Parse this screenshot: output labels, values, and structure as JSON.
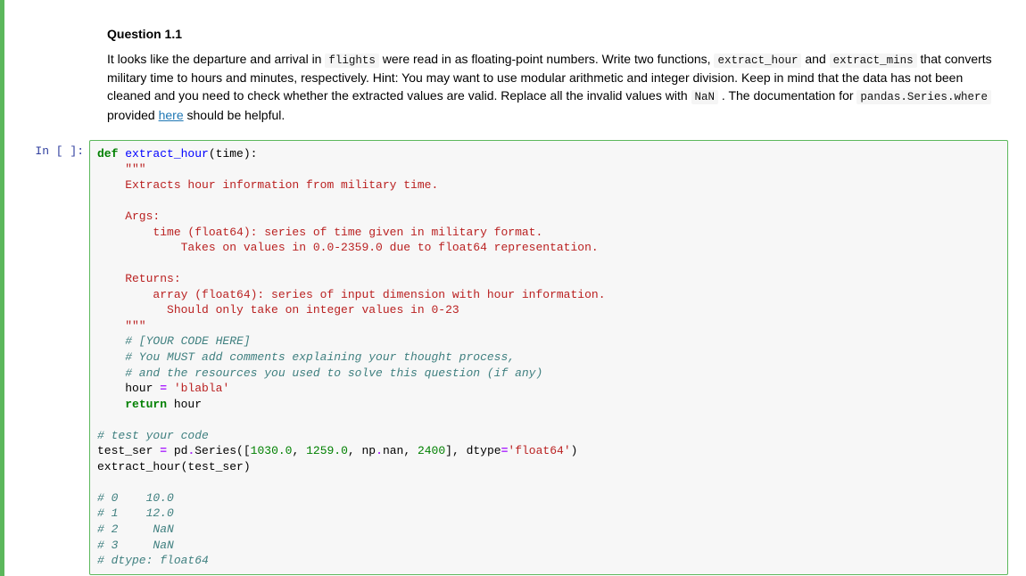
{
  "md": {
    "title": "Question 1.1",
    "p1_a": "It looks like the departure and arrival in ",
    "c_flights": "flights",
    "p1_b": " were read in as floating-point numbers. Write two functions, ",
    "c_eh": "extract_hour",
    "p1_c": " and ",
    "c_em": "extract_mins",
    "p1_d": " that converts military time to hours and minutes, respectively. Hint: You may want to use modular arithmetic and integer division. Keep in mind that the data has not been cleaned and you need to check whether the extracted values are valid. Replace all the invalid values with ",
    "c_nan": "NaN",
    "p1_e": " . The documentation for ",
    "c_psw": "pandas.Series.where",
    "p1_f": " provided ",
    "link": "here",
    "p1_g": " should be helpful."
  },
  "cell": {
    "prompt": "In [ ]:",
    "code": {
      "l1a": "def",
      "l1b": " ",
      "l1c": "extract_hour",
      "l1d": "(time):",
      "l2": "    \"\"\"",
      "l3": "    Extracts hour information from military time.",
      "l4": "",
      "l5": "    Args:",
      "l6": "        time (float64): series of time given in military format.  ",
      "l7": "            Takes on values in 0.0-2359.0 due to float64 representation.",
      "l8": "",
      "l9": "    Returns:",
      "l10": "        array (float64): series of input dimension with hour information.  ",
      "l11": "          Should only take on integer values in 0-23",
      "l12": "    \"\"\"",
      "l13": "    # [YOUR CODE HERE]",
      "l14": "    # You MUST add comments explaining your thought process,",
      "l15": "    # and the resources you used to solve this question (if any)",
      "l16a": "    hour ",
      "l16b": "=",
      "l16c": " ",
      "l16d": "'blabla'",
      "l17a": "    ",
      "l17b": "return",
      "l17c": " hour",
      "l18": "",
      "l19": "# test your code",
      "l20a": "test_ser ",
      "l20b": "=",
      "l20c": " pd",
      "l20d": ".",
      "l20e": "Series([",
      "l20f": "1030.0",
      "l20g": ", ",
      "l20h": "1259.0",
      "l20i": ", np",
      "l20j": ".",
      "l20k": "nan, ",
      "l20l": "2400",
      "l20m": "], dtype",
      "l20n": "=",
      "l20o": "'float64'",
      "l20p": ")",
      "l21": "extract_hour(test_ser)",
      "l22": "",
      "l23": "# 0    10.0",
      "l24": "# 1    12.0",
      "l25": "# 2     NaN",
      "l26": "# 3     NaN",
      "l27": "# dtype: float64"
    }
  }
}
